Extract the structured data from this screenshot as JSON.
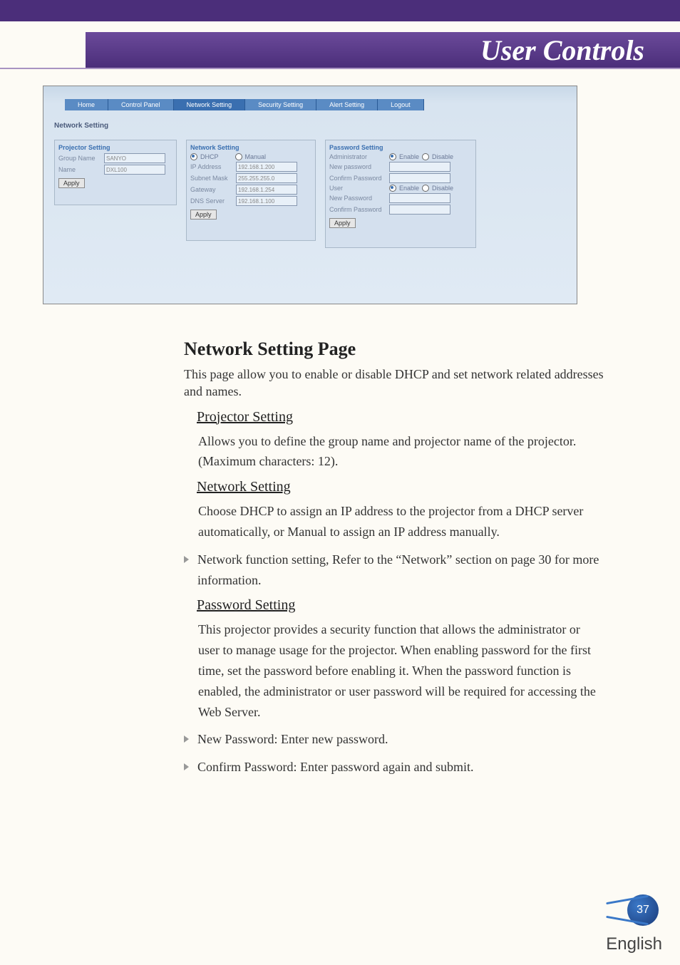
{
  "header": {
    "title": "User Controls"
  },
  "screenshot": {
    "tabs": [
      "Home",
      "Control Panel",
      "Network Setting",
      "Security Setting",
      "Alert Setting",
      "Logout"
    ],
    "section_title": "Network Setting",
    "projector": {
      "title": "Projector Setting",
      "rows": {
        "group_name_label": "Group Name",
        "group_name_value": "SANYO",
        "name_label": "Name",
        "name_value": "DXL100"
      },
      "apply": "Apply"
    },
    "network": {
      "title": "Network Setting",
      "dhcp": "DHCP",
      "manual": "Manual",
      "rows": {
        "ip_label": "IP Address",
        "ip_value": "192.168.1.200",
        "mask_label": "Subnet Mask",
        "mask_value": "255.255.255.0",
        "gw_label": "Gateway",
        "gw_value": "192.168.1.254",
        "dns_label": "DNS Server",
        "dns_value": "192.168.1.100"
      },
      "apply": "Apply"
    },
    "password": {
      "title": "Password Setting",
      "rows": {
        "admin": "Administrator",
        "enable": "Enable",
        "disable": "Disable",
        "newpw": "New password",
        "confirm": "Confirm Password",
        "user": "User",
        "newpw2": "New Password",
        "confirm2": "Confirm Password"
      },
      "apply": "Apply"
    }
  },
  "content": {
    "h2": "Network Setting Page",
    "intro": "This page allow you to enable or disable DHCP and set network related addresses and names.",
    "s1": {
      "head": "Projector Setting",
      "body": "Allows you to define the group name and projector name of the projector. (Maximum characters: 12)."
    },
    "s2": {
      "head": "Network Setting",
      "body": "Choose DHCP to assign an IP address to the projector from a DHCP server automatically, or Manual to assign an IP address manually.",
      "bullet": "Network function setting, Refer to the “Network” section on page 30 for more information."
    },
    "s3": {
      "head": "Password Setting",
      "body": "This projector provides a security function that allows the administrator or user to manage usage for the projector. When enabling password for the first time, set the password before enabling it. When the password function is enabled, the administrator or user password will be required for accessing the Web Server.",
      "bullet1": "New Password: Enter new password.",
      "bullet2": "Confirm Password: Enter password again and submit."
    }
  },
  "footer": {
    "page": "37",
    "lang": "English"
  }
}
